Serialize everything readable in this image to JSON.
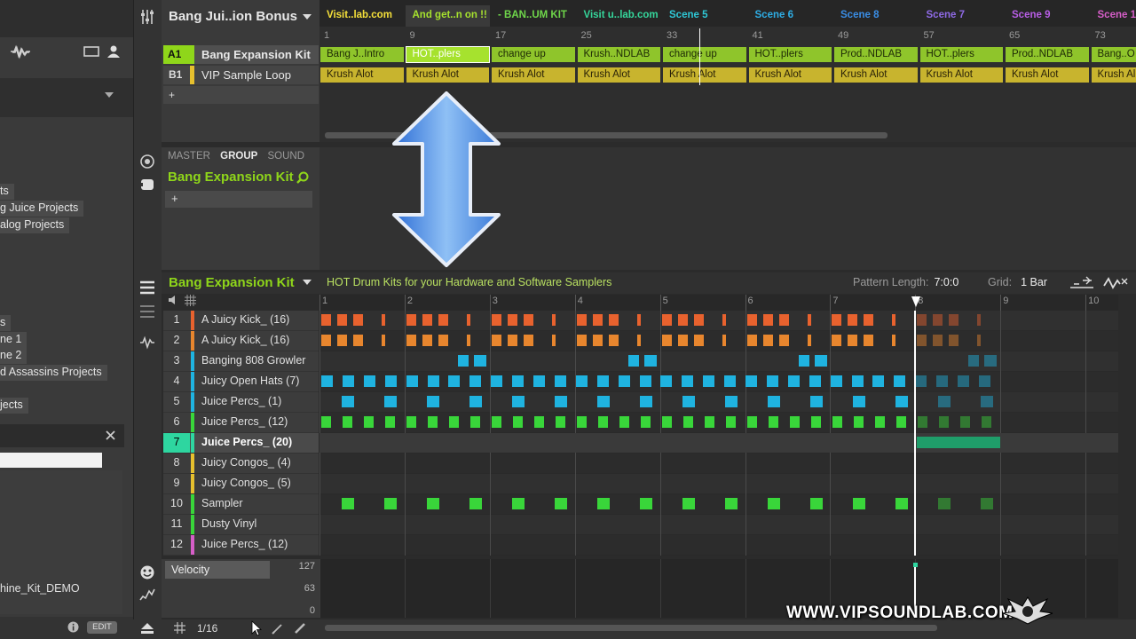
{
  "colors": {
    "accent_green": "#8fd61a",
    "clip_green": "#8fc52b",
    "clip_yellow": "#c8b42e",
    "orange": "#e8622e",
    "orange2": "#e8862e",
    "cyan": "#1fb3e0",
    "green": "#39d63a",
    "playhead": "#ffffff"
  },
  "left_panel": {
    "items": [
      "ts",
      "g Juice Projects",
      "alog Projects",
      "s",
      "ne 1",
      "ne 2",
      "d Assassins Projects",
      "jects"
    ],
    "file": "hine_Kit_DEMO",
    "edit_label": "EDIT",
    "close_icon": "close-icon"
  },
  "arranger": {
    "title": "Bang Jui..ion Bonus",
    "groups": [
      {
        "label": "A1",
        "name": "Bang Expansion Kit",
        "color": "#8fd61a"
      },
      {
        "label": "B1",
        "name": "VIP Sample Loop",
        "color": "#e6c02e"
      }
    ],
    "add_label": "+",
    "scenes": [
      {
        "name": "Visit..lab.com",
        "color": "#f5e03a"
      },
      {
        "name": "And get..n on !!",
        "color": "#a6e22e"
      },
      {
        "name": "- BAN..UM KIT",
        "color": "#6fd64a"
      },
      {
        "name": "Visit u..lab.com",
        "color": "#35d69b"
      },
      {
        "name": "Scene 5",
        "color": "#2ec8d6"
      },
      {
        "name": "Scene 6",
        "color": "#2eaee6"
      },
      {
        "name": "Scene 8",
        "color": "#3a8ee6"
      },
      {
        "name": "Scene 7",
        "color": "#8f6ae6"
      },
      {
        "name": "Scene 9",
        "color": "#b85ee6"
      },
      {
        "name": "Scene 1",
        "color": "#d65ec8"
      }
    ],
    "bar_numbers": [
      "1",
      "9",
      "17",
      "25",
      "33",
      "41",
      "49",
      "57",
      "65",
      "73"
    ],
    "row1_clips": [
      "Bang J..Intro",
      "HOT..plers",
      "change up",
      "Krush..NDLAB",
      "change up",
      "HOT..plers",
      "Prod..NDLAB",
      "HOT..plers",
      "Prod..NDLAB",
      "Bang..O"
    ],
    "row2_clips": [
      "Krush Alot",
      "Krush Alot",
      "Krush Alot",
      "Krush Alot",
      "Krush Alot",
      "Krush Alot",
      "Krush Alot",
      "Krush Alot",
      "Krush Alot",
      "Krush Al"
    ]
  },
  "sound_panel": {
    "tabs": [
      "MASTER",
      "GROUP",
      "SOUND"
    ],
    "active_tab": "GROUP",
    "kit_name": "Bang Expansion Kit",
    "add_label": "+"
  },
  "pattern": {
    "group_name": "Bang Expansion Kit",
    "description": "HOT Drum Kits for your Hardware and Software Samplers",
    "length_label": "Pattern Length:",
    "length_value": "7:0:0",
    "grid_label": "Grid:",
    "grid_value": "1 Bar",
    "ruler": [
      "1",
      "2",
      "3",
      "4",
      "5",
      "6",
      "7",
      "8",
      "9",
      "10"
    ],
    "sounds": [
      {
        "num": "1",
        "name": "A Juicy Kick_ (16)",
        "color": "#e8622e"
      },
      {
        "num": "2",
        "name": "A Juicy Kick_ (16)",
        "color": "#e8862e"
      },
      {
        "num": "3",
        "name": "Banging 808 Growler",
        "color": "#1fb3e0"
      },
      {
        "num": "4",
        "name": "Juicy Open Hats (7)",
        "color": "#1fb3e0"
      },
      {
        "num": "5",
        "name": "Juice Percs_ (1)",
        "color": "#1fb3e0"
      },
      {
        "num": "6",
        "name": "Juice Percs_ (12)",
        "color": "#39d63a"
      },
      {
        "num": "7",
        "name": "Juice Percs_ (20)",
        "color": "#2ed6a0"
      },
      {
        "num": "8",
        "name": "Juicy Congos_ (4)",
        "color": "#e6c02e"
      },
      {
        "num": "9",
        "name": "Juicy Congos_ (5)",
        "color": "#e6c02e"
      },
      {
        "num": "10",
        "name": "Sampler",
        "color": "#39d63a"
      },
      {
        "num": "11",
        "name": "Dusty Vinyl",
        "color": "#39d63a"
      },
      {
        "num": "12",
        "name": "Juice Percs_ (12)",
        "color": "#d65ec8"
      }
    ],
    "selected_sound": "7"
  },
  "velocity": {
    "label": "Velocity",
    "max": "127",
    "mid": "63",
    "min": "0"
  },
  "bottom": {
    "step": "1/16"
  },
  "watermark": "WWW.VIPSOUNDLAB.COM"
}
